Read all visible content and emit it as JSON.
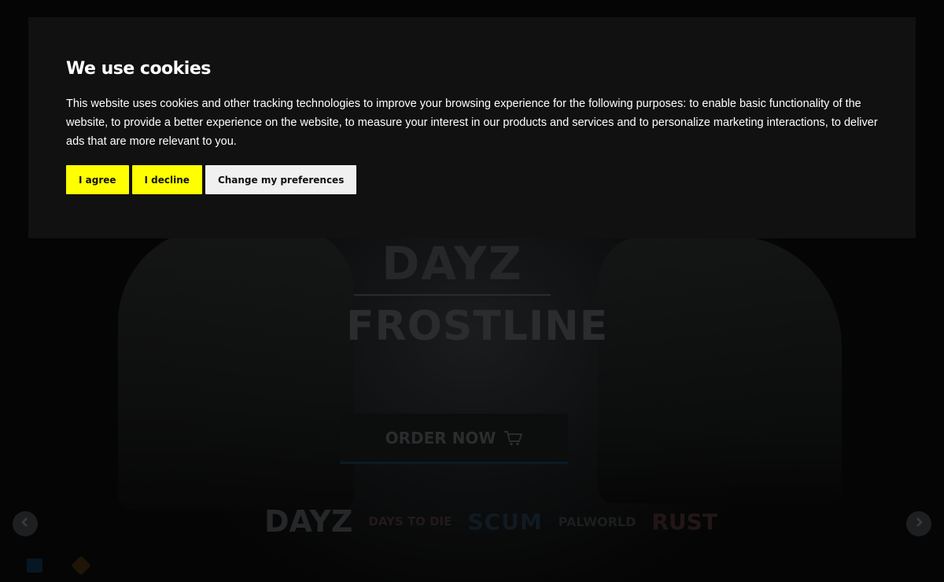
{
  "cookie": {
    "title": "We use cookies",
    "text": "This website uses cookies and other tracking technologies to improve your browsing experience for the following purposes: to enable basic functionality of the website, to provide a better experience on the website, to measure your interest in our products and services and to personalize marketing interactions, to deliver ads that are more relevant to you.",
    "agree_label": "I agree",
    "decline_label": "I decline",
    "preferences_label": "Change my preferences",
    "accent_color": "#ffff00"
  },
  "hero": {
    "logo_top": "DAYZ",
    "logo_bottom": "FROSTLINE",
    "order_label": "ORDER NOW",
    "order_icon": "cart-icon"
  },
  "games": [
    {
      "label": "DAYZ"
    },
    {
      "label": "DAYS TO DIE"
    },
    {
      "label": "SCUM"
    },
    {
      "label": "PALWORLD"
    },
    {
      "label": "RUST"
    }
  ],
  "carousel": {
    "prev_icon": "chevron-left-icon",
    "next_icon": "chevron-right-icon"
  }
}
